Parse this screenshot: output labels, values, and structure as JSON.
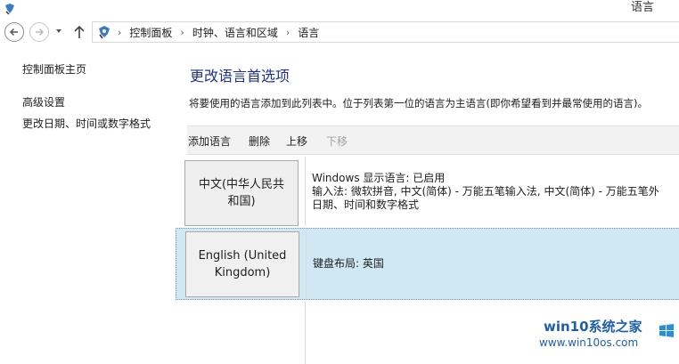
{
  "window": {
    "title": "语言"
  },
  "address_bar": {
    "crumbs": [
      "控制面板",
      "时钟、语言和区域",
      "语言"
    ]
  },
  "sidebar": {
    "home": "控制面板主页",
    "links": [
      "高级设置",
      "更改日期、时间或数字格式"
    ]
  },
  "main": {
    "heading": "更改语言首选项",
    "description": "将要使用的语言添加到此列表中。位于列表第一位的语言为主语言(即你希望看到并最常使用的语言)。",
    "toolbar": {
      "add": "添加语言",
      "remove": "删除",
      "move_up": "上移",
      "move_down": "下移"
    },
    "languages": [
      {
        "name": "中文(中华人民共和国)",
        "name_line1": "中文(中华人民共",
        "name_line2": "和国)",
        "info": [
          "Windows 显示语言: 已启用",
          "输入法: 微软拼音, 中文(简体) - 万能五笔输入法, 中文(简体) - 万能五笔外",
          "日期、时间和数字格式"
        ]
      },
      {
        "name": "English (United Kingdom)",
        "name_line1": "English (United",
        "name_line2": "Kingdom)",
        "info": [
          "键盘布局: 英国"
        ],
        "selected": true
      }
    ]
  },
  "watermark": {
    "line1": "win10系统之家",
    "line2": "www.win10os.com"
  },
  "colors": {
    "heading": "#1e3287",
    "selection": "#cfe8f4",
    "toolbar": "#f2f2f2",
    "watermark": "#1f5fa8"
  },
  "icons": [
    "app-icon",
    "back-arrow-icon",
    "forward-arrow-icon",
    "history-dropdown-icon",
    "up-arrow-icon",
    "control-panel-icon",
    "breadcrumb-chevron-icon",
    "watermark-logo-icon"
  ]
}
